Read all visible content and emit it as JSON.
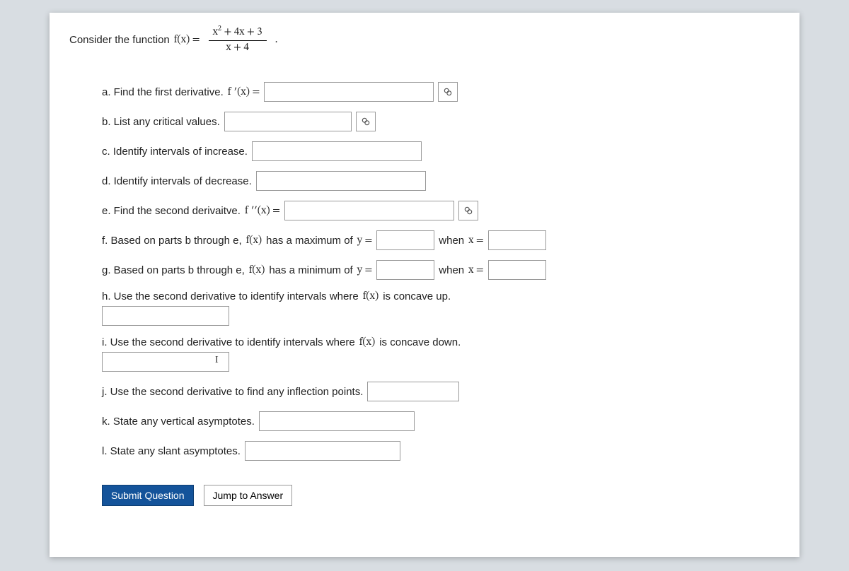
{
  "intro": {
    "prefix": "Consider the function ",
    "fx_label": "f(x) =",
    "numerator": "x",
    "num_tail": " + 4x + 3",
    "denominator": "x + 4",
    "period": "."
  },
  "parts": {
    "a": {
      "text": "a. Find the first derivative. ",
      "eq": "f ′(x) ="
    },
    "b": {
      "text": "b. List any critical values."
    },
    "c": {
      "text": "c. Identify intervals of increase."
    },
    "d": {
      "text": "d. Identify intervals of decrease."
    },
    "e": {
      "text": "e. Find the second derivaitve. ",
      "eq": "f ′′(x) ="
    },
    "f": {
      "text_before": "f. Based on parts b through e, ",
      "fx": "f(x)",
      "text_mid": " has a maximum of ",
      "y_eq": "y =",
      "when": "when ",
      "x_eq": "x ="
    },
    "g": {
      "text_before": "g. Based on parts b through e, ",
      "fx": "f(x)",
      "text_mid": " has a minimum of ",
      "y_eq": "y =",
      "when": "when ",
      "x_eq": "x ="
    },
    "h": {
      "text_before": "h. Use the second derivative to identify intervals where ",
      "fx": "f(x)",
      "text_after": " is concave up."
    },
    "i": {
      "text_before": "i. Use the second derivative to identify intervals where ",
      "fx": "f(x)",
      "text_after": " is concave down."
    },
    "j": {
      "text": "j. Use the second derivative to find any inflection points."
    },
    "k": {
      "text": "k. State any vertical asymptotes."
    },
    "l": {
      "text": "l. State any slant asymptotes."
    }
  },
  "buttons": {
    "submit": "Submit Question",
    "jump": "Jump to Answer"
  },
  "icons": {
    "preview": "🔗"
  },
  "cursor": "I"
}
